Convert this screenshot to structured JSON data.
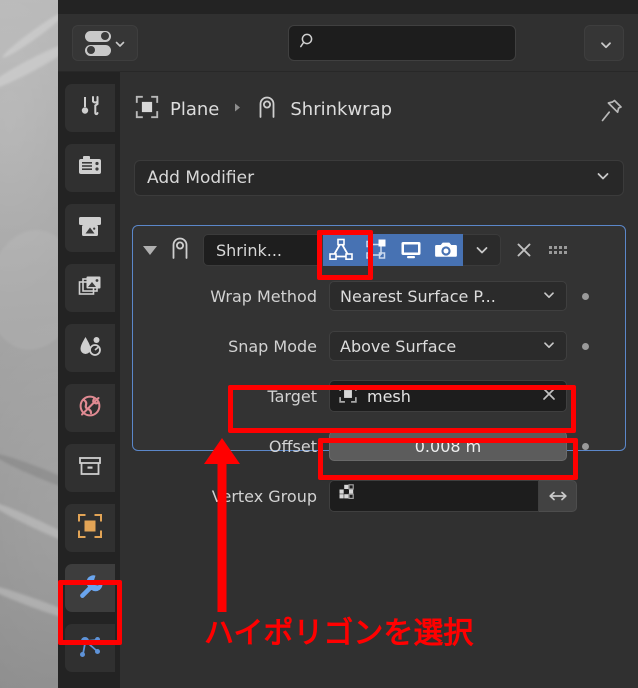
{
  "app": "blender-properties-editor",
  "viewport": {
    "name": "3d-viewport-preview"
  },
  "header": {
    "filter_icon": "display-filter-toggles-icon",
    "filter_chevron": "chevron-down-icon",
    "search": {
      "icon": "search-icon",
      "value": "",
      "placeholder": ""
    },
    "menu_chevron": "chevron-down-icon"
  },
  "tabs": [
    {
      "name": "tool",
      "icon": "tool-screwdriver-wrench-icon",
      "active": false,
      "color": "#cfcfcf"
    },
    {
      "name": "render",
      "icon": "render-camera-back-icon",
      "active": false,
      "color": "#cfcfcf"
    },
    {
      "name": "output",
      "icon": "output-printer-icon",
      "active": false,
      "color": "#cfcfcf"
    },
    {
      "name": "view-layer",
      "icon": "view-layer-images-icon",
      "active": false,
      "color": "#cfcfcf"
    },
    {
      "name": "scene",
      "icon": "scene-cone-droplet-icon",
      "active": false,
      "color": "#cfcfcf"
    },
    {
      "name": "world",
      "icon": "world-globe-icon",
      "active": false,
      "color": "#e08a92"
    },
    {
      "name": "collection",
      "icon": "collection-box-icon",
      "active": false,
      "color": "#cfcfcf"
    },
    {
      "name": "object",
      "icon": "object-square-brackets-icon",
      "active": false,
      "color": "#e2a456"
    },
    {
      "name": "modifier",
      "icon": "modifier-wrench-icon",
      "active": true,
      "color": "#6aa5ee"
    },
    {
      "name": "particles",
      "icon": "particles-nodes-icon",
      "active": false,
      "color": "#6aa5ee"
    }
  ],
  "breadcrumb": {
    "object_icon": "object-square-brackets-icon",
    "object_label": "Plane",
    "separator_icon": "chevron-right-small-icon",
    "modifier_icon": "modifier-shrinkwrap-icon",
    "modifier_label": "Shrinkwrap",
    "pin_icon": "pin-icon"
  },
  "add_modifier": {
    "label": "Add Modifier",
    "chevron_icon": "chevron-down-icon"
  },
  "modifier": {
    "expand_icon": "triangle-down-icon",
    "type_icon": "modifier-shrinkwrap-icon",
    "name": "Shrink...",
    "toggles": [
      {
        "name": "on-cage",
        "icon": "on-cage-triangle-icon",
        "enabled": false,
        "highlighted": true
      },
      {
        "name": "edit-mode",
        "icon": "edit-mode-box-icon",
        "enabled": true,
        "highlighted": false
      },
      {
        "name": "realtime",
        "icon": "realtime-monitor-icon",
        "enabled": true,
        "highlighted": false
      },
      {
        "name": "render",
        "icon": "render-camera-icon",
        "enabled": true,
        "highlighted": false
      }
    ],
    "extras_icon": "chevron-down-icon",
    "close_icon": "close-x-icon",
    "grip_icon": "drag-grip-dots-icon",
    "rows": [
      {
        "label": "Wrap Method",
        "kind": "dropdown",
        "value": "Nearest Surface P...",
        "chevron": "chevron-down-icon",
        "decorator": true
      },
      {
        "label": "Snap Mode",
        "kind": "dropdown",
        "value": "Above Surface",
        "chevron": "chevron-down-icon",
        "decorator": true
      },
      {
        "label": "Target",
        "kind": "object",
        "value": "mesh",
        "icon": "object-square-brackets-icon",
        "clear_icon": "close-x-icon",
        "decorator": false
      },
      {
        "label": "Offset",
        "kind": "value",
        "value": "0.008 m",
        "decorator": true
      },
      {
        "label": "Vertex Group",
        "kind": "vertexgroup",
        "value": "",
        "icon": "vertex-group-dots-icon",
        "invert_icon": "invert-arrows-icon",
        "decorator": false
      }
    ]
  },
  "annotations": {
    "color": "#ff0000",
    "caption": "ハイポリゴンを選択",
    "boxes": [
      "modifier-tab-highlight",
      "on-cage-toggle-highlight",
      "target-row-highlight",
      "offset-field-highlight"
    ],
    "arrow": "arrow-up-to-target"
  }
}
